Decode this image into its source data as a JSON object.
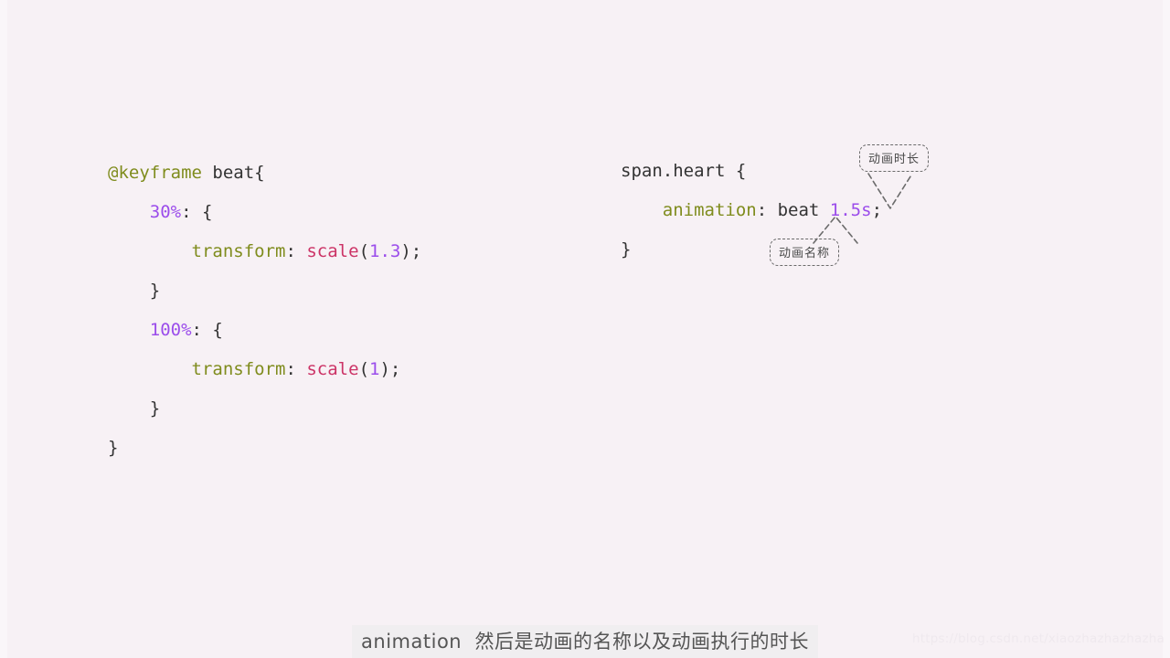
{
  "background_color": "#f7f1f5",
  "code_left": {
    "name": "keyframes-definition",
    "lines": [
      [
        {
          "t": "@keyframe",
          "c": "at"
        },
        {
          "t": " beat{",
          "c": "plain"
        }
      ],
      [
        {
          "t": "    ",
          "c": "plain"
        },
        {
          "t": "30%",
          "c": "num"
        },
        {
          "t": ": {",
          "c": "plain"
        }
      ],
      [
        {
          "t": "        ",
          "c": "plain"
        },
        {
          "t": "transform",
          "c": "prop"
        },
        {
          "t": ": ",
          "c": "plain"
        },
        {
          "t": "scale",
          "c": "fn"
        },
        {
          "t": "(",
          "c": "plain"
        },
        {
          "t": "1.3",
          "c": "num"
        },
        {
          "t": ");",
          "c": "plain"
        }
      ],
      [
        {
          "t": "    }",
          "c": "plain"
        }
      ],
      [
        {
          "t": "    ",
          "c": "plain"
        },
        {
          "t": "100%",
          "c": "num"
        },
        {
          "t": ": {",
          "c": "plain"
        }
      ],
      [
        {
          "t": "        ",
          "c": "plain"
        },
        {
          "t": "transform",
          "c": "prop"
        },
        {
          "t": ": ",
          "c": "plain"
        },
        {
          "t": "scale",
          "c": "fn"
        },
        {
          "t": "(",
          "c": "plain"
        },
        {
          "t": "1",
          "c": "num"
        },
        {
          "t": ");",
          "c": "plain"
        }
      ],
      [
        {
          "t": "    }",
          "c": "plain"
        }
      ],
      [
        {
          "t": "}",
          "c": "plain"
        }
      ]
    ]
  },
  "code_right": {
    "name": "animation-usage",
    "lines": [
      [
        {
          "t": "span.heart {",
          "c": "plain"
        }
      ],
      [
        {
          "t": "    ",
          "c": "plain"
        },
        {
          "t": "animation",
          "c": "prop"
        },
        {
          "t": ": beat ",
          "c": "plain"
        },
        {
          "t": "1.5s",
          "c": "num"
        },
        {
          "t": ";",
          "c": "plain"
        }
      ],
      [
        {
          "t": "}",
          "c": "plain"
        }
      ]
    ]
  },
  "callouts": {
    "duration": {
      "label": "动画时长",
      "points_to": "1.5s"
    },
    "name": {
      "label": "动画名称",
      "points_to": "beat"
    }
  },
  "subtitle": {
    "text": "animation  然后是动画的名称以及动画执行的时长"
  },
  "watermark": {
    "text": "https://blog.csdn.net/xiaozhazhazhazha"
  },
  "token_colors": {
    "at_rule": "#7f8c1d",
    "property": "#7f8c1d",
    "number": "#9b4deb",
    "function": "#cc3366",
    "plain": "#333333"
  }
}
